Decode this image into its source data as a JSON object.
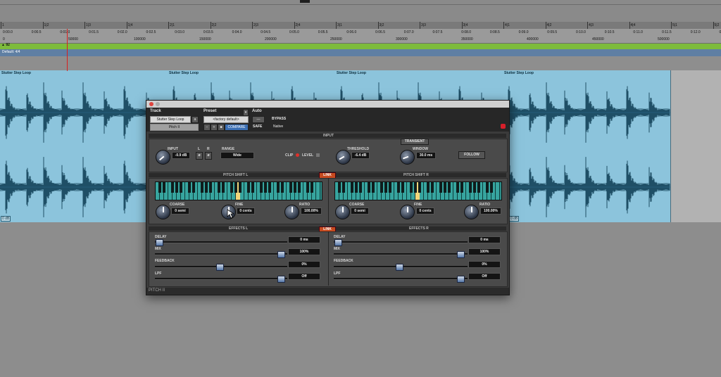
{
  "rulers": {
    "bars": [
      "1",
      "1|2",
      "1|3",
      "1|4",
      "2|1",
      "2|2",
      "2|3",
      "2|4",
      "3|1",
      "3|2",
      "3|3",
      "3|4",
      "4|1",
      "4|2",
      "4|3",
      "4|4",
      "5|1",
      "5|2"
    ],
    "mins": [
      "0:00.0",
      "0:00.5",
      "0:01.0",
      "0:01.5",
      "0:02.0",
      "0:02.5",
      "0:03.0",
      "0:03.5",
      "0:04.0",
      "0:04.5",
      "0:05.0",
      "0:05.5",
      "0:06.0",
      "0:06.5",
      "0:07.0",
      "0:07.5",
      "0:08.0",
      "0:08.5",
      "0:09.0",
      "0:09.5",
      "0:10.0",
      "0:10.5",
      "0:11.0",
      "0:11.5",
      "0:12.0",
      "0:12.5"
    ],
    "samples": [
      "0",
      "50000",
      "100000",
      "150000",
      "200000",
      "250000",
      "300000",
      "350000",
      "400000",
      "450000",
      "500000"
    ]
  },
  "tempo_label": "▲ 92",
  "meter_label": "Default: 4/4",
  "clips": [
    {
      "name": "Stutter Step Loop"
    },
    {
      "name": "Stutter Step Loop"
    },
    {
      "name": "Stutter Step Loop"
    },
    {
      "name": "Stutter Step Loop"
    }
  ],
  "clip_badges": [
    "0 dB",
    "0 dB"
  ],
  "plugin": {
    "header": {
      "track_label": "Track",
      "preset_label": "Preset",
      "auto_label": "Auto",
      "track_name": "Stutter Step Loop",
      "track_suffix": "a",
      "plugin_name": "Pitch II",
      "preset_name": "<factory default>",
      "preset_minus": "−",
      "preset_plus": "+",
      "compare": "COMPARE",
      "bypass": "BYPASS",
      "safe": "SAFE",
      "native": "Native"
    },
    "input": {
      "section_title": "INPUT",
      "input_label": "INPUT",
      "input_value": "-0.9 dB",
      "l_label": "L",
      "r_label": "R",
      "range_label": "RANGE",
      "range_value": "Wide",
      "clip_label": "CLIP",
      "level_label": "LEVEL",
      "threshold_label": "THRESHOLD",
      "threshold_value": "-6.4 dB",
      "transient_label": "TRANSIENT",
      "window_label": "WINDOW",
      "window_value": "30.0 ms",
      "follow_label": "FOLLOW"
    },
    "pitch_l": {
      "title": "PITCH SHIFT L",
      "coarse_label": "COARSE",
      "coarse_value": "0 semi",
      "fine_label": "FINE",
      "fine_value": "0 cents",
      "ratio_label": "RATIO",
      "ratio_value": "100.00%"
    },
    "pitch_r": {
      "title": "PITCH SHIFT R",
      "coarse_label": "COARSE",
      "coarse_value": "0 semi",
      "fine_label": "FINE",
      "fine_value": "0 cents",
      "ratio_label": "RATIO",
      "ratio_value": "100.00%"
    },
    "link_label": "LINK",
    "effects_l": {
      "title": "EFFECTS L",
      "delay_label": "DELAY",
      "delay_value": "0 ms",
      "mix_label": "MIX",
      "mix_value": "100%",
      "feedback_label": "FEEDBACK",
      "feedback_value": "0%",
      "lpf_label": "LPF",
      "lpf_value": "Off"
    },
    "effects_r": {
      "title": "EFFECTS R",
      "delay_label": "DELAY",
      "delay_value": "0 ms",
      "mix_label": "MIX",
      "mix_value": "100%",
      "feedback_label": "FEEDBACK",
      "feedback_value": "0%",
      "lpf_label": "LPF",
      "lpf_value": "Off"
    },
    "footer_name": "PITCH II"
  },
  "colors": {
    "clip": "#8cc4dc",
    "waveform": "#1f4f66",
    "tempo_lane": "#7dbb3c",
    "meter_lane": "#5f7fa3",
    "accent_link": "#c64a1f",
    "key_highlight": "#f2d67a"
  }
}
